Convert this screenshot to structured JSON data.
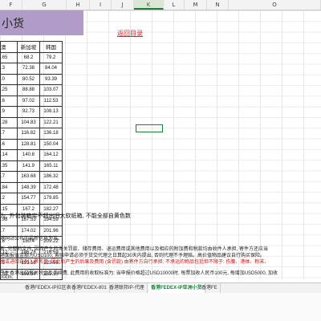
{
  "columns": [
    "F",
    "G",
    "H",
    "I",
    "J",
    "K",
    "L",
    "M",
    "N",
    "O"
  ],
  "selected_column": "K",
  "title": "小货",
  "return_link": "返回目录",
  "table": {
    "headers": [
      "澳",
      "新加坡",
      "韩国"
    ],
    "rows": [
      [
        ".65",
        "68.2",
        "79.2"
      ],
      [
        ".3",
        "72.38",
        "84.04"
      ],
      [
        ".0",
        "80.52",
        "93.39"
      ],
      [
        ".25",
        "88.88",
        "103.07"
      ],
      [
        ".6",
        "97.02",
        "112.53"
      ],
      [
        ".9",
        "92.73",
        "108.13"
      ],
      [
        ".28",
        "104.83",
        "122.21"
      ],
      [
        ".7",
        "116.82",
        "136.18"
      ],
      [
        ".6",
        "128.81",
        "150.04"
      ],
      [
        ".14",
        "140.8",
        "164.12"
      ],
      [
        ".35",
        "141.9",
        "165.11"
      ],
      [
        ".7",
        "163.68",
        "186.32"
      ],
      [
        ".84",
        "148.39",
        "172.48"
      ],
      [
        ".2",
        "154.77",
        "179.85"
      ],
      [
        ".15",
        "167.2",
        "182.27"
      ],
      [
        ".98",
        "167.53",
        "194.59"
      ],
      [
        ".7",
        "174.02",
        "201.96"
      ],
      [
        ".8",
        "180.4",
        "209.22"
      ],
      [
        ".12",
        "186.78",
        "216.59"
      ],
      [
        ".5",
        "193.16",
        "223.96"
      ],
      [
        ".88",
        "199.54",
        "231.33"
      ]
    ]
  },
  "note": "为, 外包装箱实不超出旧大软纸箱, 不能全部自黄色数",
  "text_lines": [
    "港网站公布的最新信息为准。",
    "新: 完整的文件, 因而产生的海关罚款、储存费用、退运费用或其他费用以及相应的附加费和税款均由收件人承担, 寄件方还应当",
    "港面报值金额为USD100, 索赔申请必须于货交代理之日算起30天内提出, 否则代理不予理赔。高价值物品建议自行购买保险。",
    "物或进回自列入黑名单, 因此所产生的后果及费用 (含罚款) 由寄件方自行承担; 不承运的物品包括但不限于: 伤腰、港体、粉末、",
    "产生香港出口报关税金及手续费, 此费用的收取标准为: 当申报价格超过USD10000时, 每票加收人民币100元, 每增加USD5000, 加收",
    "00cm;",
    "单件重量和操作件按照单件标价, 用加可200元..."
  ],
  "sheet_tabs": [
    "香港FEDEX-IP拉区表",
    "香港FEDEX-801",
    "香港联邦IP-代理",
    "香港FEDEX-IP亚洲小货",
    "香港FE"
  ],
  "active_tab_index": 3
}
